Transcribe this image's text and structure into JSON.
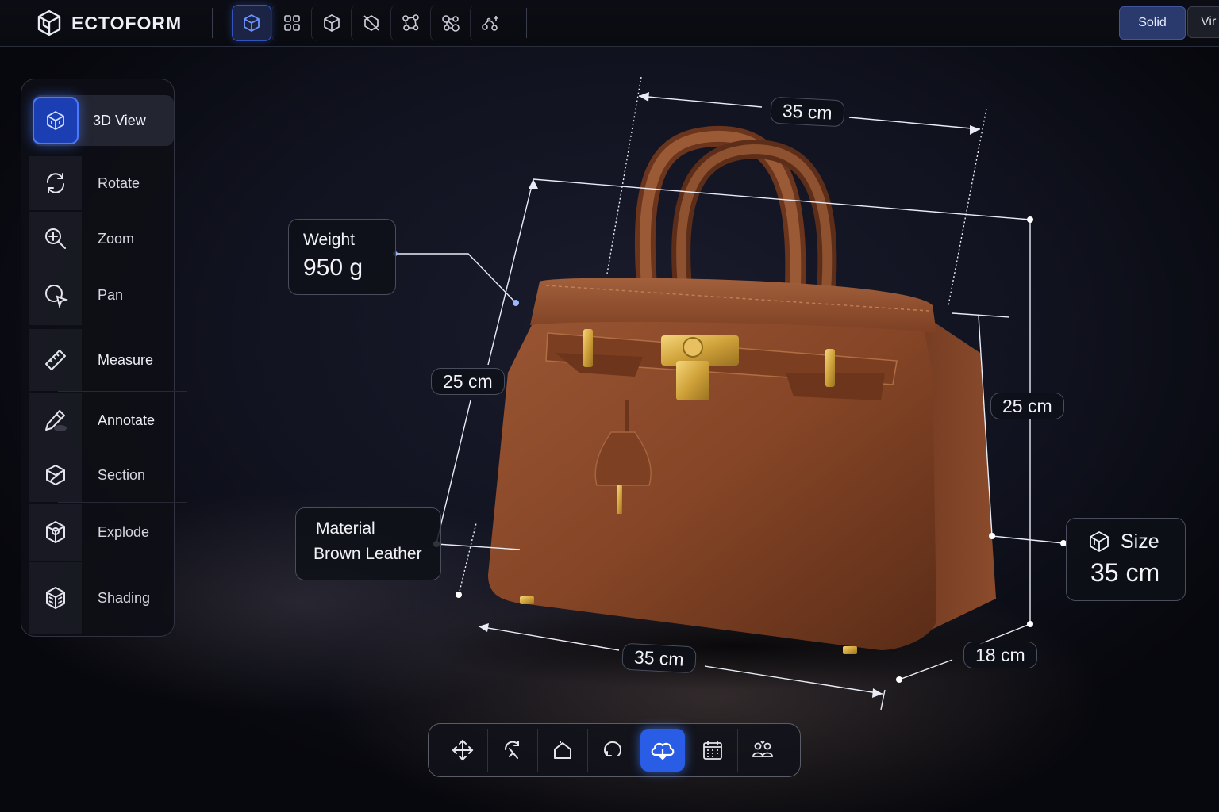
{
  "app": {
    "name": "ECTOFORM"
  },
  "topbar": {
    "tools": [
      {
        "icon": "cube-icon",
        "active": true
      },
      {
        "icon": "grid-icon",
        "active": false
      },
      {
        "icon": "box-icon",
        "active": false
      },
      {
        "icon": "no-geometry-icon",
        "active": false
      },
      {
        "icon": "nodes-icon",
        "active": false
      },
      {
        "icon": "network-icon",
        "active": false
      },
      {
        "icon": "sparkle-icon",
        "active": false
      }
    ],
    "solid_label": "Solid",
    "second_mode_label": "Vir"
  },
  "sidebar": {
    "items": [
      {
        "label": "3D View",
        "icon": "cube-icon",
        "active": true
      },
      {
        "label": "Rotate",
        "icon": "rotate-icon"
      },
      {
        "label": "Zoom",
        "icon": "zoom-icon"
      },
      {
        "label": "Pan",
        "icon": "pan-icon"
      },
      {
        "label": "Measure",
        "icon": "ruler-icon"
      },
      {
        "label": "Annotate",
        "icon": "pencil-icon"
      },
      {
        "label": "Section",
        "icon": "section-icon"
      },
      {
        "label": "Explode",
        "icon": "explode-icon"
      },
      {
        "label": "Shading",
        "icon": "shading-icon"
      }
    ]
  },
  "annotations": {
    "weight": {
      "label": "Weight",
      "value": "950 g"
    },
    "material": {
      "label": "Material",
      "value": "Brown Leather"
    },
    "size": {
      "label": "Size",
      "value": "35 cm"
    },
    "dimensions": {
      "top_width": "35 cm",
      "left_height": "25 cm",
      "right_height": "25 cm",
      "bottom_width": "35 cm",
      "depth": "18 cm"
    }
  },
  "bottombar": {
    "tools": [
      {
        "icon": "move-icon"
      },
      {
        "icon": "rotate-tool-icon"
      },
      {
        "icon": "home-icon"
      },
      {
        "icon": "orbit-icon"
      },
      {
        "icon": "cloud-icon",
        "active": true
      },
      {
        "icon": "calendar-icon"
      },
      {
        "icon": "people-icon"
      }
    ]
  },
  "colors": {
    "accent": "#2a5de6",
    "accent_glow": "#4b78ff",
    "leather": "#8a4a2c",
    "gold": "#d7a93c",
    "panel": "#0e0f16"
  }
}
